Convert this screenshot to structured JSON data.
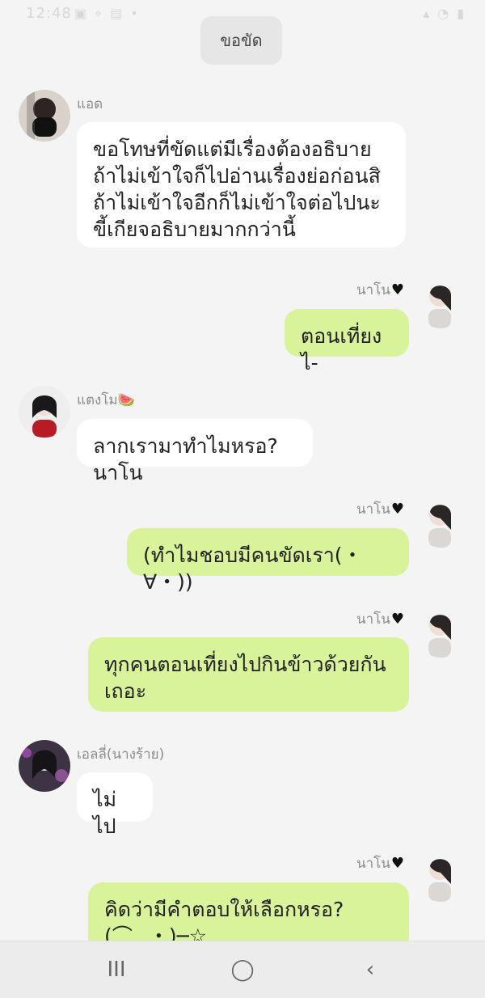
{
  "status_bar": {
    "time": "12:48",
    "left_icons": [
      "gallery-icon",
      "location-icon",
      "image-icon",
      "more-icon"
    ],
    "right_icons": [
      "signal-icon",
      "wifi-icon",
      "battery-icon"
    ]
  },
  "system_chip": {
    "label": "ขอขัด"
  },
  "messages": [
    {
      "side": "left",
      "sender": "แอด",
      "text": "ขอโทษที่ขัดแต่มีเรื่องต้องอธิบายถ้าไม่เข้าใจก็ไปอ่านเรื่องย่อก่อนสิถ้าไม่เข้าใจอีกก็ไม่เข้าใจต่อไปนะ ขี้เกียจอธิบายมากกว่านี้"
    },
    {
      "side": "right",
      "sender": "นาโน",
      "text": "ตอนเที่ยงไ-"
    },
    {
      "side": "left",
      "sender": "แตงโม",
      "text": "ลากเรามาทำไมหรอ?นาโน"
    },
    {
      "side": "right",
      "sender": "นาโน",
      "text": "(ทำไมชอบมีคนขัดเรา(・∀・))"
    },
    {
      "side": "right",
      "sender": "นาโน",
      "text": "ทุกคนตอนเที่ยงไปกินข้าวด้วยกันเถอะ"
    },
    {
      "side": "left",
      "sender": "เอลลี่(นางร้าย)",
      "text": "ไม่ไป"
    },
    {
      "side": "right",
      "sender": "นาโน",
      "text": "คิดว่ามีคำตอบให้เลือกหรอ?(⌒‿・)─☆"
    }
  ],
  "nav_bar": {
    "recent_label": "III",
    "home_label": "◯",
    "back_label": "‹"
  },
  "colors": {
    "background": "#f4f4f4",
    "incoming_bubble": "#ffffff",
    "outgoing_bubble": "#d8f39a",
    "name_text": "#8c8c8c"
  }
}
